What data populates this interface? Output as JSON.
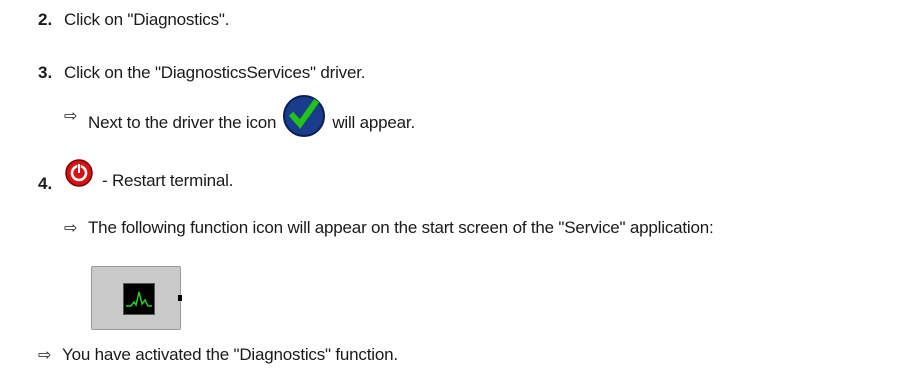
{
  "steps": [
    {
      "number": "2.",
      "text": "Click on \"Diagnostics\"."
    },
    {
      "number": "3.",
      "text": "Click on the \"DiagnosticsServices\" driver."
    },
    {
      "number": "4.",
      "text": "- Restart terminal."
    }
  ],
  "results": {
    "arrow": "⇨",
    "driver_icon_before": "Next to the driver the icon",
    "driver_icon_after": "will appear.",
    "function_icon": "The following function icon will appear on the start screen of the \"Service\" application:",
    "final": "You have activated the \"Diagnostics\" function."
  },
  "icons": {
    "driver_status": "check-icon",
    "restart": "restart-icon",
    "function": "diagnostics-function-icon"
  },
  "colors": {
    "check_bg": "#1a3c8c",
    "check_mark": "#22c21a",
    "restart_red": "#d81010",
    "function_wave": "#27d127"
  }
}
